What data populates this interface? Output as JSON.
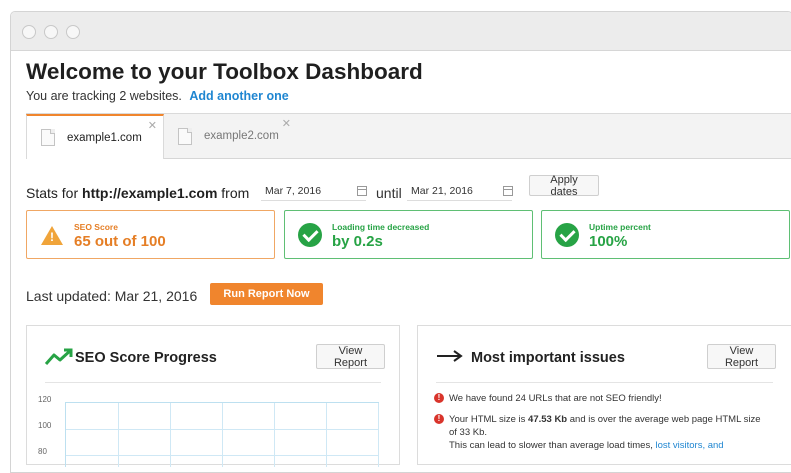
{
  "header": {
    "title": "Welcome to your Toolbox Dashboard",
    "tracking_text": "You are tracking 2 websites.",
    "add_link": "Add another one"
  },
  "tabs": [
    {
      "label": "example1.com",
      "active": true
    },
    {
      "label": "example2.com",
      "active": false
    }
  ],
  "stats": {
    "prefix": "Stats for",
    "site": "http://example1.com",
    "from_label": "from",
    "from_date": "Mar 7, 2016",
    "until_label": "until",
    "until_date": "Mar 21, 2016",
    "apply_label": "Apply dates"
  },
  "cards": [
    {
      "label": "SEO Score",
      "value": "65 out of 100",
      "status": "warning",
      "color": "#e57e25"
    },
    {
      "label": "Loading time decreased",
      "value": "by 0.2s",
      "status": "ok",
      "color": "#27a345"
    },
    {
      "label": "Uptime percent",
      "value": "100%",
      "status": "ok",
      "color": "#27a345"
    }
  ],
  "updated": {
    "text": "Last updated: Mar 21, 2016",
    "run_label": "Run Report Now"
  },
  "progress_panel": {
    "title": "SEO Score Progress",
    "view_label": "View Report",
    "ticks": [
      "120",
      "100",
      "80"
    ]
  },
  "issues_panel": {
    "title": "Most important issues",
    "view_label": "View Report",
    "issue1": "We have found 24 URLs that are not SEO friendly!",
    "issue2_pre": "Your HTML size is",
    "issue2_size": "47.53 Kb",
    "issue2_post": "and is over the average web page HTML size of 33 Kb.",
    "issue2_line2": "This can lead to slower than average load times,",
    "issue2_link": "lost visitors, and"
  },
  "colors": {
    "accent": "#f0852d",
    "link": "#1f86d1",
    "ok": "#27a345",
    "warn": "#e57e25"
  },
  "icons": [
    "warning-icon",
    "check-circle-icon",
    "trend-up-icon",
    "arrow-right-icon",
    "calendar-icon",
    "document-icon",
    "close-icon",
    "alert-icon"
  ]
}
